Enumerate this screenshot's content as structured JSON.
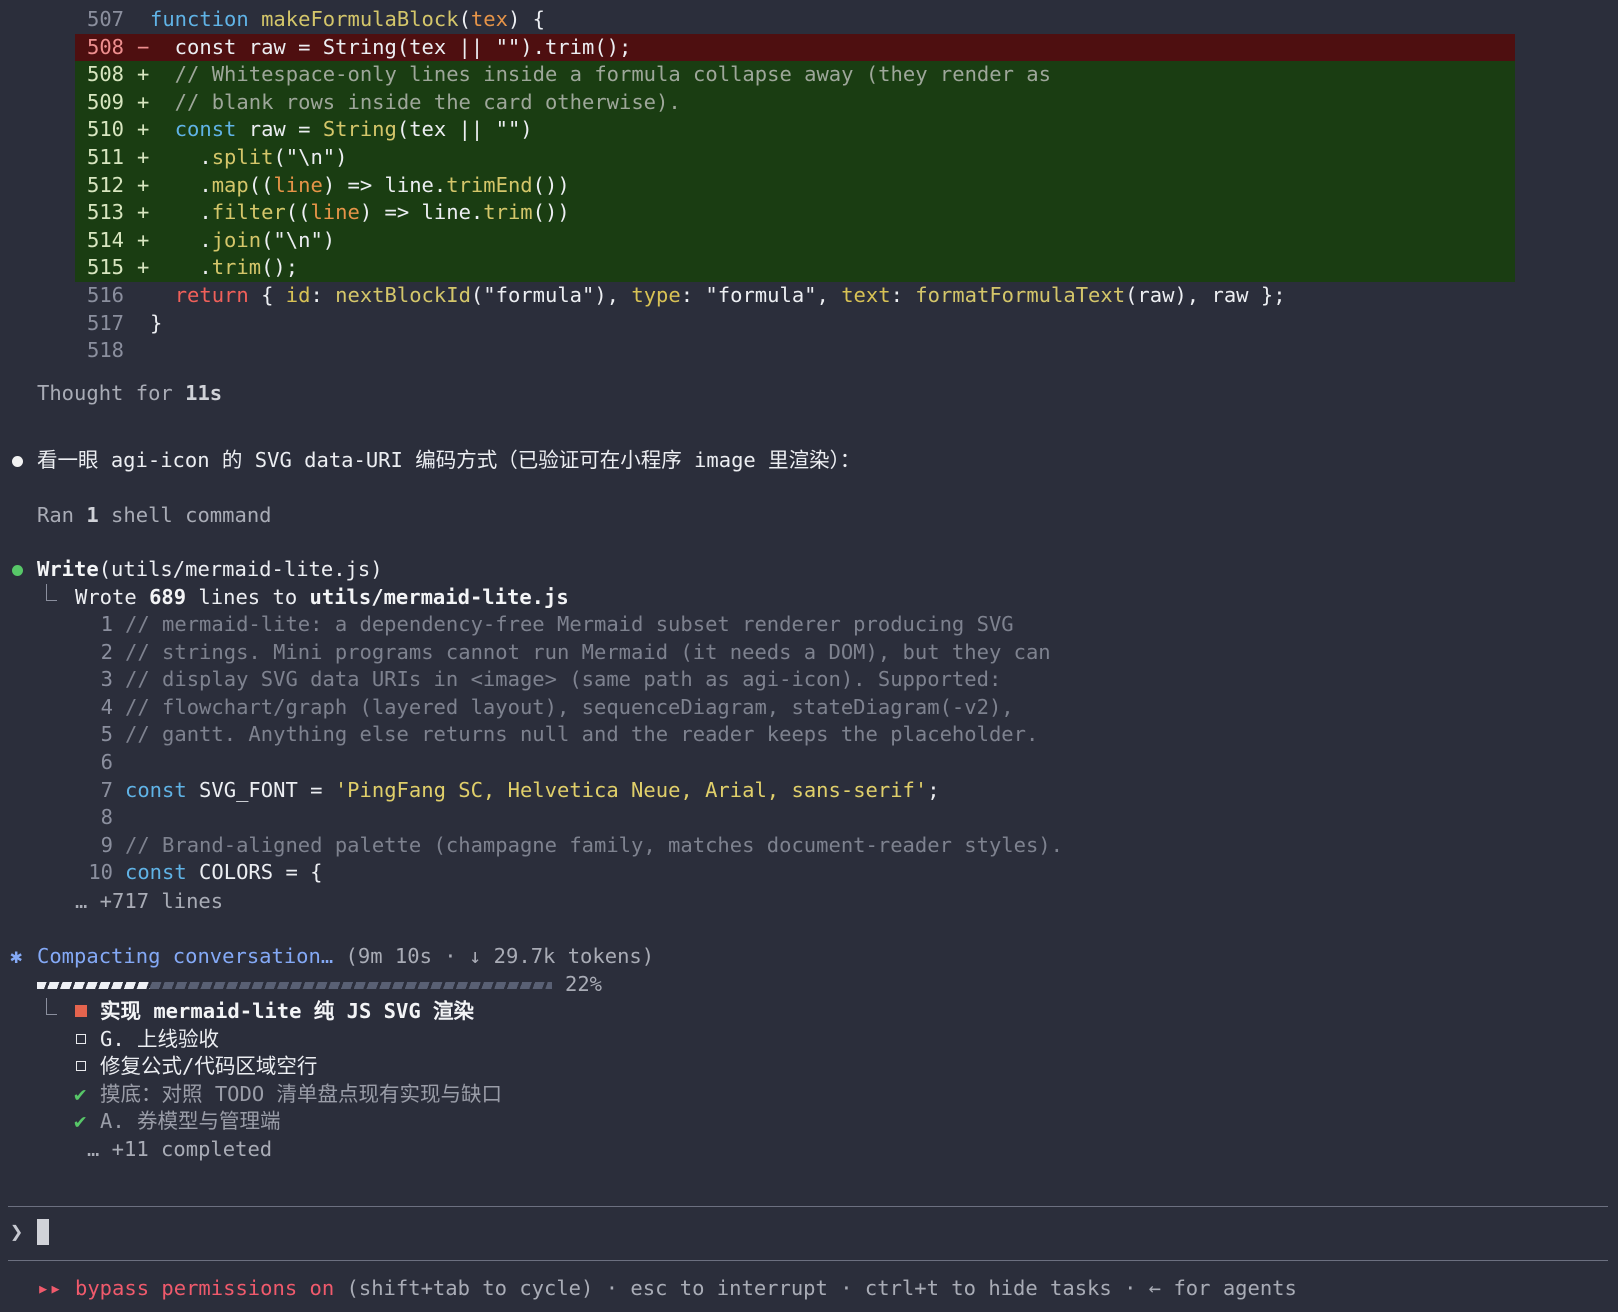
{
  "diff": {
    "lines": [
      {
        "num": "507",
        "mark": "",
        "kind": "ctx",
        "tokens": [
          {
            "t": "function",
            "c": "kw"
          },
          {
            "t": " "
          },
          {
            "t": "makeFormulaBlock",
            "c": "fn"
          },
          {
            "t": "("
          },
          {
            "t": "tex",
            "c": "param"
          },
          {
            "t": ") {"
          }
        ]
      },
      {
        "num": "508",
        "mark": "−",
        "kind": "del",
        "tokens": [
          {
            "t": "  const raw = String(tex || \"\").trim();",
            "c": "txt"
          }
        ]
      },
      {
        "num": "508",
        "mark": "+",
        "kind": "add",
        "tokens": [
          {
            "t": "  // Whitespace-only lines inside a formula collapse away (they render as",
            "c": "cmt"
          }
        ]
      },
      {
        "num": "509",
        "mark": "+",
        "kind": "add",
        "tokens": [
          {
            "t": "  // blank rows inside the card otherwise).",
            "c": "cmt"
          }
        ]
      },
      {
        "num": "510",
        "mark": "+",
        "kind": "add",
        "tokens": [
          {
            "t": "  "
          },
          {
            "t": "const",
            "c": "kw"
          },
          {
            "t": " raw = "
          },
          {
            "t": "String",
            "c": "fn"
          },
          {
            "t": "(tex || \"\")"
          }
        ]
      },
      {
        "num": "511",
        "mark": "+",
        "kind": "add",
        "tokens": [
          {
            "t": "    ."
          },
          {
            "t": "split",
            "c": "fn"
          },
          {
            "t": "(\"\\n\")"
          }
        ]
      },
      {
        "num": "512",
        "mark": "+",
        "kind": "add",
        "tokens": [
          {
            "t": "    ."
          },
          {
            "t": "map",
            "c": "fn"
          },
          {
            "t": "(("
          },
          {
            "t": "line",
            "c": "param"
          },
          {
            "t": ") => line."
          },
          {
            "t": "trimEnd",
            "c": "fn"
          },
          {
            "t": "())"
          }
        ]
      },
      {
        "num": "513",
        "mark": "+",
        "kind": "add",
        "tokens": [
          {
            "t": "    ."
          },
          {
            "t": "filter",
            "c": "fn"
          },
          {
            "t": "(("
          },
          {
            "t": "line",
            "c": "param"
          },
          {
            "t": ") => line."
          },
          {
            "t": "trim",
            "c": "fn"
          },
          {
            "t": "())"
          }
        ]
      },
      {
        "num": "514",
        "mark": "+",
        "kind": "add",
        "tokens": [
          {
            "t": "    ."
          },
          {
            "t": "join",
            "c": "fn"
          },
          {
            "t": "(\"\\n\")"
          }
        ]
      },
      {
        "num": "515",
        "mark": "+",
        "kind": "add",
        "tokens": [
          {
            "t": "    ."
          },
          {
            "t": "trim",
            "c": "fn"
          },
          {
            "t": "();"
          }
        ]
      },
      {
        "num": "516",
        "mark": "",
        "kind": "ctx",
        "tokens": [
          {
            "t": "  "
          },
          {
            "t": "return",
            "c": "ret"
          },
          {
            "t": " { "
          },
          {
            "t": "id",
            "c": "prop"
          },
          {
            "t": ": "
          },
          {
            "t": "nextBlockId",
            "c": "fn"
          },
          {
            "t": "(\"formula\"), "
          },
          {
            "t": "type",
            "c": "prop"
          },
          {
            "t": ": \"formula\", "
          },
          {
            "t": "text",
            "c": "prop"
          },
          {
            "t": ": "
          },
          {
            "t": "formatFormulaText",
            "c": "fn"
          },
          {
            "t": "(raw), raw };"
          }
        ]
      },
      {
        "num": "517",
        "mark": "",
        "kind": "ctx",
        "tokens": [
          {
            "t": "}"
          }
        ]
      },
      {
        "num": "518",
        "mark": "",
        "kind": "ctx",
        "tokens": []
      }
    ]
  },
  "thought": {
    "prefix": "Thought for ",
    "duration": "11s"
  },
  "message": {
    "text": "看一眼 agi-icon 的 SVG data-URI 编码方式（已验证可在小程序 image 里渲染）："
  },
  "ran": {
    "prefix": "Ran ",
    "count": "1",
    "suffix": " shell command"
  },
  "write": {
    "tool": "Write",
    "arg": "(utils/mermaid-lite.js)",
    "result_prefix": "Wrote ",
    "result_count": "689",
    "result_mid": " lines to ",
    "result_path": "utils/mermaid-lite.js",
    "preview": [
      {
        "num": "1",
        "tokens": [
          {
            "t": "// mermaid-lite: a dependency-free Mermaid subset renderer producing SVG",
            "c": "cmt2"
          }
        ]
      },
      {
        "num": "2",
        "tokens": [
          {
            "t": "// strings. Mini programs cannot run Mermaid (it needs a DOM), but they can",
            "c": "cmt2"
          }
        ]
      },
      {
        "num": "3",
        "tokens": [
          {
            "t": "// display SVG data URIs in <image> (same path as agi-icon). Supported:",
            "c": "cmt2"
          }
        ]
      },
      {
        "num": "4",
        "tokens": [
          {
            "t": "// flowchart/graph (layered layout), sequenceDiagram, stateDiagram(-v2),",
            "c": "cmt2"
          }
        ]
      },
      {
        "num": "5",
        "tokens": [
          {
            "t": "// gantt. Anything else returns null and the reader keeps the placeholder.",
            "c": "cmt2"
          }
        ]
      },
      {
        "num": "6",
        "tokens": []
      },
      {
        "num": "7",
        "tokens": [
          {
            "t": "const",
            "c": "kw"
          },
          {
            "t": " SVG_FONT = "
          },
          {
            "t": "'PingFang SC, Helvetica Neue, Arial, sans-serif'",
            "c": "str"
          },
          {
            "t": ";"
          }
        ]
      },
      {
        "num": "8",
        "tokens": []
      },
      {
        "num": "9",
        "tokens": [
          {
            "t": "// Brand-aligned palette (champagne family, matches document-reader styles).",
            "c": "cmt2"
          }
        ]
      },
      {
        "num": "10",
        "tokens": [
          {
            "t": "const",
            "c": "kw"
          },
          {
            "t": " COLORS = {"
          }
        ]
      }
    ],
    "more": "… +717 lines"
  },
  "compacting": {
    "star": "✱",
    "label": "Compacting conversation…",
    "meta": " (9m 10s · ↓ 29.7k tokens)",
    "progress": 0.22,
    "percent": "22%"
  },
  "tasks": {
    "items": [
      {
        "status": "in_progress",
        "label": "实现 mermaid-lite 纯 JS SVG 渲染"
      },
      {
        "status": "pending",
        "label": "G. 上线验收"
      },
      {
        "status": "pending",
        "label": "修复公式/代码区域空行"
      },
      {
        "status": "done",
        "label": "摸底：对照 TODO 清单盘点现有实现与缺口"
      },
      {
        "status": "done",
        "label": "A. 券模型与管理端"
      }
    ],
    "more": "… +11 completed"
  },
  "prompt": {
    "caret": "❯"
  },
  "footer": {
    "arrows": "▸▸",
    "mode": "bypass permissions on",
    "hint": " (shift+tab to cycle) · esc to interrupt · ctrl+t to hide tasks · ← for agents"
  }
}
